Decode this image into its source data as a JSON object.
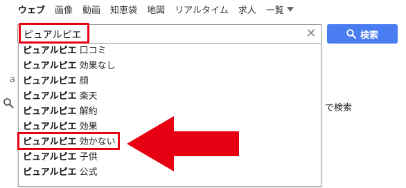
{
  "nav": {
    "items": [
      "ウェブ",
      "画像",
      "動画",
      "知恵袋",
      "地図",
      "リアルタイム",
      "求人"
    ],
    "more_label": "一覧"
  },
  "search": {
    "value": "ピュアルピエ",
    "button_label": "検索"
  },
  "background": {
    "partial_text": "で検索",
    "partial_letter": "a"
  },
  "suggestions": {
    "query": "ピュアルピエ",
    "items": [
      "口コミ",
      "効果なし",
      "顔",
      "楽天",
      "解約",
      "効果",
      "効かない",
      "子供",
      "公式"
    ],
    "highlighted_index": 6
  },
  "colors": {
    "highlight": "#e60012",
    "button": "#4a7cf2",
    "arrow": "#e60012"
  },
  "icons": {
    "search": "search-icon",
    "clear": "close-icon",
    "more": "triangle-down-icon"
  }
}
